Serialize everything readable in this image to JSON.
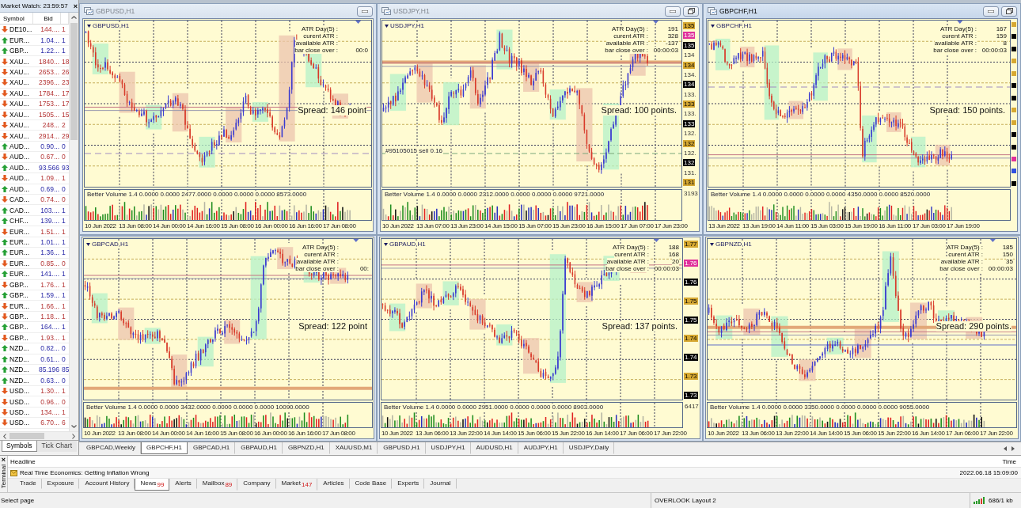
{
  "market_watch": {
    "title": "Market Watch: 23:59:57",
    "close": "×",
    "columns": [
      "Symbol",
      "Bid"
    ],
    "rows": [
      {
        "symbol": "DE10...",
        "bid": "144....",
        "ask": "1",
        "up": false
      },
      {
        "symbol": "EUR...",
        "bid": "1.04...",
        "ask": "1",
        "up": true
      },
      {
        "symbol": "GBP...",
        "bid": "1.22...",
        "ask": "1",
        "up": true
      },
      {
        "symbol": "XAU...",
        "bid": "1840...",
        "ask": "18",
        "up": false
      },
      {
        "symbol": "XAU...",
        "bid": "2653...",
        "ask": "26",
        "up": false
      },
      {
        "symbol": "XAU...",
        "bid": "2396...",
        "ask": "23",
        "up": false
      },
      {
        "symbol": "XAU...",
        "bid": "1784...",
        "ask": "17",
        "up": false
      },
      {
        "symbol": "XAU...",
        "bid": "1753...",
        "ask": "17",
        "up": false
      },
      {
        "symbol": "XAU...",
        "bid": "1505...",
        "ask": "15",
        "up": false
      },
      {
        "symbol": "XAU...",
        "bid": "248...",
        "ask": "2",
        "up": false
      },
      {
        "symbol": "XAU...",
        "bid": "2914...",
        "ask": "29",
        "up": false
      },
      {
        "symbol": "AUD...",
        "bid": "0.90...",
        "ask": "0",
        "up": true
      },
      {
        "symbol": "AUD...",
        "bid": "0.67...",
        "ask": "0",
        "up": false
      },
      {
        "symbol": "AUD...",
        "bid": "93.566",
        "ask": "93",
        "up": true
      },
      {
        "symbol": "AUD...",
        "bid": "1.09...",
        "ask": "1",
        "up": false
      },
      {
        "symbol": "AUD...",
        "bid": "0.69...",
        "ask": "0",
        "up": true
      },
      {
        "symbol": "CAD...",
        "bid": "0.74...",
        "ask": "0",
        "up": false
      },
      {
        "symbol": "CAD...",
        "bid": "103....",
        "ask": "1",
        "up": true
      },
      {
        "symbol": "CHF...",
        "bid": "139....",
        "ask": "1",
        "up": true
      },
      {
        "symbol": "EUR...",
        "bid": "1.51...",
        "ask": "1",
        "up": false
      },
      {
        "symbol": "EUR...",
        "bid": "1.01...",
        "ask": "1",
        "up": true
      },
      {
        "symbol": "EUR...",
        "bid": "1.36...",
        "ask": "1",
        "up": true
      },
      {
        "symbol": "EUR...",
        "bid": "0.85...",
        "ask": "0",
        "up": false
      },
      {
        "symbol": "EUR...",
        "bid": "141....",
        "ask": "1",
        "up": true
      },
      {
        "symbol": "GBP...",
        "bid": "1.76...",
        "ask": "1",
        "up": false
      },
      {
        "symbol": "GBP...",
        "bid": "1.59...",
        "ask": "1",
        "up": true
      },
      {
        "symbol": "EUR...",
        "bid": "1.66...",
        "ask": "1",
        "up": false
      },
      {
        "symbol": "GBP...",
        "bid": "1.18...",
        "ask": "1",
        "up": false
      },
      {
        "symbol": "GBP...",
        "bid": "164....",
        "ask": "1",
        "up": true
      },
      {
        "symbol": "GBP...",
        "bid": "1.93...",
        "ask": "1",
        "up": false
      },
      {
        "symbol": "NZD...",
        "bid": "0.82...",
        "ask": "0",
        "up": true
      },
      {
        "symbol": "NZD...",
        "bid": "0.61...",
        "ask": "0",
        "up": true
      },
      {
        "symbol": "NZD...",
        "bid": "85.196",
        "ask": "85",
        "up": true
      },
      {
        "symbol": "NZD...",
        "bid": "0.63...",
        "ask": "0",
        "up": true
      },
      {
        "symbol": "USD...",
        "bid": "1.30...",
        "ask": "1",
        "up": false
      },
      {
        "symbol": "USD...",
        "bid": "0.96...",
        "ask": "0",
        "up": false
      },
      {
        "symbol": "USD...",
        "bid": "134....",
        "ask": "1",
        "up": false
      },
      {
        "symbol": "USD...",
        "bid": "6.70...",
        "ask": "6",
        "up": false
      }
    ],
    "tabs": [
      {
        "label": "Symbols",
        "selected": true
      },
      {
        "label": "Tick Chart",
        "selected": false
      }
    ]
  },
  "charts": [
    {
      "title": "GBPUSD,H1",
      "active": false,
      "minimize_button": true,
      "symbol": "GBPUSD,H1",
      "atr": [
        {
          "label": "ATR Day(5) :"
        },
        {
          "label": "curent ATR :"
        },
        {
          "label": "available ATR :"
        },
        {
          "label": "bar close over :",
          "value": "00:0"
        }
      ],
      "spread": "Spread: 146 point",
      "volume_label": "Better Volume 1.4 0.0000 0.0000 2477.0000 0.0000 0.0000 0.0000 8573.0000",
      "time_labels": [
        "10 Jun 2022",
        "13 Jun 08:00",
        "14 Jun 00:00",
        "14 Jun 16:00",
        "15 Jun 08:00",
        "16 Jun 00:00",
        "16 Jun 16:00",
        "17 Jun 08:00"
      ]
    },
    {
      "title": "USDJPY,H1",
      "active": false,
      "minimize_button": true,
      "restore_button": true,
      "symbol": "USDJPY,H1",
      "atr": [
        {
          "label": "ATR Day(5) :",
          "value": "191"
        },
        {
          "label": "curent ATR :",
          "value": "328"
        },
        {
          "label": "available ATR :",
          "value": "-137"
        },
        {
          "label": "bar close over :",
          "value": "00:00:03"
        }
      ],
      "spread": "Spread: 100 points.",
      "order_label": "#95105015 sell 0.16",
      "volume_label": "Better Volume 1.4 0.0000 0.0000 2312.0000 0.0000 0.0000 0.0000 9721.0000",
      "price_axis": [
        {
          "text": "135",
          "kind": "gold"
        },
        {
          "text": "135",
          "kind": "pink"
        },
        {
          "text": "135",
          "kind": "black"
        },
        {
          "text": "134",
          "kind": "plain"
        },
        {
          "text": "134",
          "kind": "gold"
        },
        {
          "text": "134.",
          "kind": "plain"
        },
        {
          "text": "134",
          "kind": "black"
        },
        {
          "text": "133.",
          "kind": "plain"
        },
        {
          "text": "133",
          "kind": "gold"
        },
        {
          "text": "133.",
          "kind": "plain"
        },
        {
          "text": "133",
          "kind": "black"
        },
        {
          "text": "132.",
          "kind": "plain"
        },
        {
          "text": "132",
          "kind": "gold"
        },
        {
          "text": "132.",
          "kind": "plain"
        },
        {
          "text": "132",
          "kind": "black"
        },
        {
          "text": "131.",
          "kind": "plain"
        },
        {
          "text": "131",
          "kind": "gold"
        }
      ],
      "volume_axis": [
        "3193"
      ],
      "time_labels": [
        "10 Jun 2022",
        "13 Jun 07:00",
        "13 Jun 23:00",
        "14 Jun 15:00",
        "15 Jun 07:00",
        "15 Jun 23:00",
        "16 Jun 15:00",
        "17 Jun 07:00",
        "17 Jun 23:00"
      ]
    },
    {
      "title": "GBPCHF,H1",
      "active": true,
      "minimize_button": true,
      "restore_button": true,
      "symbol": "GBPCHF,H1",
      "atr": [
        {
          "label": "ATR Day(5) :",
          "value": "167"
        },
        {
          "label": "curent ATR :",
          "value": "159"
        },
        {
          "label": "available ATR :",
          "value": "8"
        },
        {
          "label": "bar close over :",
          "value": "00:00:03"
        }
      ],
      "spread": "Spread: 150 points.",
      "volume_label": "Better Volume 1.4 0.0000 0.0000 0.0000 0.0000 4350.0000 0.0000 8520.0000",
      "price_axis": [
        {
          "kind": "gold"
        },
        {
          "kind": "black"
        },
        {
          "kind": "black"
        },
        {
          "kind": "gold"
        },
        {
          "kind": "gold"
        },
        {
          "kind": "black"
        },
        {
          "kind": "black"
        },
        {
          "kind": "gold"
        },
        {
          "kind": "gold"
        },
        {
          "kind": "black"
        },
        {
          "kind": "black"
        },
        {
          "kind": "pink"
        },
        {
          "kind": "blue"
        },
        {
          "kind": "black"
        }
      ],
      "time_labels": [
        "13 Jun 2022",
        "13 Jun 19:00",
        "14 Jun 11:00",
        "15 Jun 03:00",
        "15 Jun 19:00",
        "16 Jun 11:00",
        "17 Jun 03:00",
        "17 Jun 19:00"
      ]
    },
    {
      "symbol": "GBPCAD,H1",
      "atr": [
        {
          "label": "ATR Day(5) :"
        },
        {
          "label": "curent ATR :"
        },
        {
          "label": "available ATR :"
        },
        {
          "label": "bar close over :",
          "value": "00:"
        }
      ],
      "spread": "Spread: 122 point",
      "volume_label": "Better Volume 1.4 0.0000 0.0000 3432.0000 0.0000 0.0000 0.0000 10090.0000",
      "time_labels": [
        "10 Jun 2022",
        "13 Jun 08:00",
        "14 Jun 00:00",
        "14 Jun 16:00",
        "15 Jun 08:00",
        "16 Jun 00:00",
        "16 Jun 16:00",
        "17 Jun 08:00"
      ]
    },
    {
      "symbol": "GBPAUD,H1",
      "atr": [
        {
          "label": "ATR Day(5) :",
          "value": "188"
        },
        {
          "label": "curent ATR :",
          "value": "168"
        },
        {
          "label": "available ATR :",
          "value": "20"
        },
        {
          "label": "bar close over :",
          "value": "00:00:03"
        }
      ],
      "spread": "Spread: 137 points.",
      "volume_label": "Better Volume 1.4 0.0000 0.0000 2951.0000 0.0000 0.0000 0.0000 8903.0000",
      "price_axis": [
        {
          "text": "1.77",
          "kind": "gold"
        },
        {
          "text": "1.76",
          "kind": "pink"
        },
        {
          "text": "1.76",
          "kind": "black"
        },
        {
          "text": "1.75",
          "kind": "gold"
        },
        {
          "text": "1.75",
          "kind": "black"
        },
        {
          "text": "1.74",
          "kind": "gold"
        },
        {
          "text": "1.74",
          "kind": "black"
        },
        {
          "text": "1.73",
          "kind": "gold"
        },
        {
          "text": "1.73",
          "kind": "black"
        }
      ],
      "volume_axis": [
        "6417"
      ],
      "time_labels": [
        "10 Jun 2022",
        "13 Jun 06:00",
        "13 Jun 22:00",
        "14 Jun 14:00",
        "15 Jun 06:00",
        "15 Jun 22:00",
        "16 Jun 14:00",
        "17 Jun 06:00",
        "17 Jun 22:00"
      ]
    },
    {
      "symbol": "GBPNZD,H1",
      "atr": [
        {
          "label": "ATR Day(5) :",
          "value": "185"
        },
        {
          "label": "curent ATR :",
          "value": "150"
        },
        {
          "label": "available ATR :",
          "value": "35"
        },
        {
          "label": "bar close over :",
          "value": "00:00:03"
        }
      ],
      "spread": "Spread: 290 points.",
      "volume_label": "Better Volume 1.4 0.0000 0.0000 3350.0000 0.0000 0.0000 0.0000 9055.0000",
      "time_labels": [
        "10 Jun 2022",
        "13 Jun 06:00",
        "13 Jun 22:00",
        "14 Jun 14:00",
        "15 Jun 06:00",
        "15 Jun 22:00",
        "16 Jun 14:00",
        "17 Jun 06:00",
        "17 Jun 22:00"
      ]
    }
  ],
  "chart_tabs": [
    {
      "label": "GBPCAD,Weekly",
      "selected": false
    },
    {
      "label": "GBPCHF,H1",
      "selected": true
    },
    {
      "label": "GBPCAD,H1",
      "selected": false
    },
    {
      "label": "GBPAUD,H1",
      "selected": false
    },
    {
      "label": "GBPNZD,H1",
      "selected": false
    },
    {
      "label": "XAUUSD,M1",
      "selected": false
    },
    {
      "label": "GBPUSD,H1",
      "selected": false
    },
    {
      "label": "USDJPY,H1",
      "selected": false
    },
    {
      "label": "AUDUSD,H1",
      "selected": false
    },
    {
      "label": "AUDJPY,H1",
      "selected": false
    },
    {
      "label": "USDJPY,Daily",
      "selected": false
    }
  ],
  "terminal": {
    "close": "×",
    "title": "Terminal",
    "columns": [
      "Headline",
      "Time"
    ],
    "news": [
      {
        "headline": "Real Time Economics: Getting Inflation Wrong",
        "time": "2022.06.18 15:09:00"
      }
    ],
    "tabs": [
      {
        "label": "Trade",
        "selected": false
      },
      {
        "label": "Exposure",
        "selected": false
      },
      {
        "label": "Account History",
        "selected": false
      },
      {
        "label": "News",
        "count": "99",
        "selected": true
      },
      {
        "label": "Alerts",
        "selected": false
      },
      {
        "label": "Mailbox",
        "count": "89",
        "selected": false
      },
      {
        "label": "Company",
        "selected": false
      },
      {
        "label": "Market",
        "count": "147",
        "selected": false
      },
      {
        "label": "Articles",
        "selected": false
      },
      {
        "label": "Code Base",
        "selected": false
      },
      {
        "label": "Experts",
        "selected": false
      },
      {
        "label": "Journal",
        "selected": false
      }
    ]
  },
  "status_bar": {
    "hint": "Select page",
    "profile": "OVERLOOK Layout 2",
    "traffic": "686/1 kb"
  }
}
